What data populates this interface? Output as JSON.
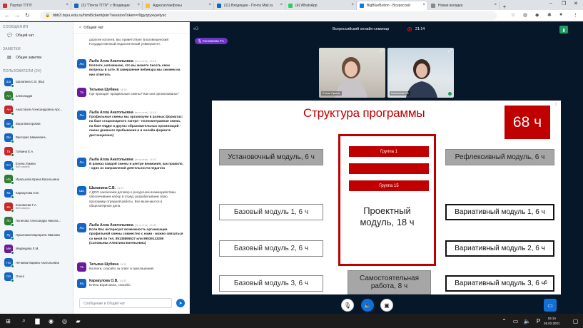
{
  "browser": {
    "tabs": [
      {
        "label": "Портал ТГПУ",
        "color": "#d32f2f"
      },
      {
        "label": "(3) \"Почта ТГПУ\" с Входящие",
        "color": "#1565c0"
      },
      {
        "label": "Адресатлаефоны",
        "color": "#fbc02d"
      },
      {
        "label": "(11) Входящие - Почта Mail.ru",
        "color": "#1565c0"
      },
      {
        "label": "(4) WhatsApp",
        "color": "#25d366"
      },
      {
        "label": "BigBlueButton - Всероссий",
        "color": "#1a73e8"
      },
      {
        "label": "Новая вкладка",
        "color": "#888888"
      }
    ],
    "url": "bbb3.tspu.edu.ru/html5client/join?sessionToken=r9gyzpyxvyetyxc",
    "new_tab": "+"
  },
  "sidebar": {
    "messages_heading": "СООБЩЕНИЯ",
    "public_chat": "Общий чат",
    "notes_heading": "ЗАМЕТКИ",
    "shared_notes": "Общие заметки",
    "users_heading": "ПОЛЬЗОВАТЕЛИ (24)",
    "users": [
      {
        "initials": "Ша",
        "name": "Шалапина С.В. (Вы)",
        "sub": "",
        "color": "#1565c0"
      },
      {
        "initials": "Ал",
        "name": "александра",
        "sub": "",
        "color": "#2e7d32"
      },
      {
        "initials": "Ан",
        "name": "Анастасия Александровна Арх...",
        "sub": "",
        "color": "#c62828"
      },
      {
        "initials": "Ве",
        "name": "Вера Викторовна",
        "sub": "",
        "color": "#1565c0"
      },
      {
        "initials": "Ви",
        "name": "Виктория Шимкевичь",
        "sub": "",
        "color": "#1565c0"
      },
      {
        "initials": "Га",
        "name": "Галкина Е.А.",
        "sub": "",
        "color": "#c62828"
      },
      {
        "initials": "Ел",
        "name": "Елена Лукина",
        "sub": "Веб камера",
        "color": "#1565c0"
      },
      {
        "initials": "Иа",
        "name": "Иральнова Ирина Васильевна",
        "sub": "",
        "color": "#2e7d32"
      },
      {
        "initials": "Ка",
        "name": "Каракулова О.В.",
        "sub": "",
        "color": "#1565c0"
      },
      {
        "initials": "Ко",
        "name": "Коновеева Т.А.",
        "sub": "Веб камера",
        "color": "#c62828"
      },
      {
        "initials": "Ло",
        "name": "Логинова Александра Никола...",
        "sub": "",
        "color": "#2e7d32"
      },
      {
        "initials": "Лу",
        "name": "Лукьянова Маргарита Иванова",
        "sub": "",
        "color": "#1565c0"
      },
      {
        "initials": "Ме",
        "name": "Медведева Л.М.",
        "sub": "",
        "color": "#6a1b9a"
      },
      {
        "initials": "На",
        "name": "Нечаева Марина Анатольевна",
        "sub": "",
        "color": "#1565c0"
      },
      {
        "initials": "Ол",
        "name": "Ольга",
        "sub": "",
        "color": "#1565c0"
      }
    ]
  },
  "chat": {
    "header": "Общий чат",
    "m0": "дорогие коллеги, вас приветствует Благовещенский Государственный педагогический университет.",
    "m1_name": "Лыба Алла Анатольевна",
    "m1_meta": "(не в сети)",
    "m1_time": "14:16",
    "m1_text": "Коллеги, напоминаю, что вы можете писать свои вопросы в чате. В завершение вебинара мы сможем на них ответить",
    "m2_name": "Татьяна Шубина",
    "m2_time": "14:16",
    "m2_text": "Где проходят профильные смены? Как они организованы?",
    "m3_name": "Лыба Алла Анатольевна",
    "m3_meta": "(не в сети)",
    "m3_time": "14:18",
    "m3_text": "Профильные смены мы организуем в разных форматах: на базе стационарного лагеря - полнометражная смена, на базе ОЦДО и других образовательных организаций - смена дневного пребывания и в онлайн-формате дистанционно)",
    "m4_name": "Лыба Алла Анатольевна",
    "m4_meta": "(не в сети)",
    "m4_time": "14:22",
    "m4_text": "В рамках каждой смены в центре внимания, как правило, - одно из направлений деятельности педагога",
    "m5_name": "Шалапина С.В.",
    "m5_time": "14:27",
    "m5_text": "с ДОО заключаем договор о ресурсном взаимодействии, обеспечиваем набор в отряд, разрабатываем свою программу отрядной работы. Все включаются в общелагерные дела",
    "m6_name": "Лыба Алла Анатольевна",
    "m6_meta": "(не в сети)",
    "m6_time": "14:30",
    "m6_text": "Если Вас интересует возможность организации профильной смены совместно с нами - можно связаться со мной по тел. 89138895527 или 89539133289 (Соловьева Алевтина Евгеньевна)",
    "m7_name": "Татьяна Шубина",
    "m7_time": "14:31",
    "m7_text": "Коллеги, спасибо за ответ и приглашение!",
    "m8_name": "Каракулова О.В.",
    "m8_time": "14:33",
    "m8_text": "Елена Борисовна, спасибо",
    "input_placeholder": "Сообщение в Общий чат"
  },
  "main": {
    "title": "Всероссийский онлайн-семинар",
    "rec_time": "21:14",
    "presenter": "Коновеева ТА",
    "videos": [
      {
        "label": "Елена Лукина"
      },
      {
        "label": "Коновеева ТА"
      }
    ]
  },
  "slide": {
    "title": "Структура программы",
    "hours_badge": "68 ч",
    "modules": {
      "install": "Установочный модуль, 6 ч",
      "reflex": "Рефлексивный модуль, 6 ч",
      "base1": "Базовый модуль 1, 6 ч",
      "var1": "Вариативный модуль 1, 6 ч",
      "base2": "Базовый модуль 2, 6 ч",
      "var2": "Вариативный модуль 2, 6 ч",
      "base3": "Базовый модуль 3, 6 ч",
      "var3": "Вариативный модуль 3, 6 ч",
      "self_line1": "Самостоятельная",
      "self_line2": "работа, 8 ч"
    },
    "group1": "Группа 1",
    "group2": "",
    "group15": "Группа 15",
    "project_line1": "Проектный",
    "project_line2": "модуль, 18 ч",
    "page_number": "6"
  },
  "taskbar": {
    "time": "15:14",
    "date": "26.02.2021"
  }
}
